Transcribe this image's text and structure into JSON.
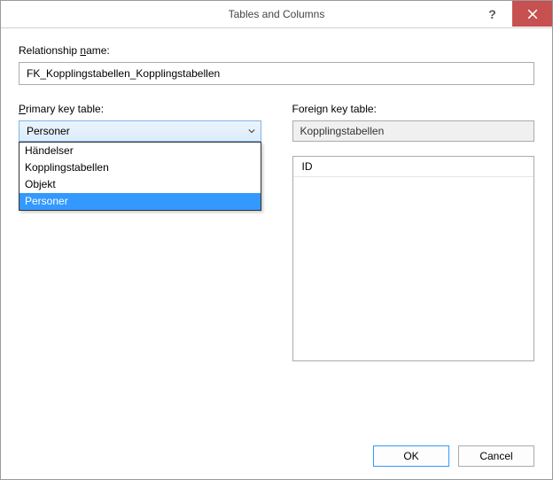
{
  "titlebar": {
    "title": "Tables and Columns"
  },
  "labels": {
    "relationship_name": "Relationship name:",
    "relationship_name_accesskey": "n",
    "primary_key_table": "Primary key table:",
    "primary_key_table_accesskey": "P",
    "foreign_key_table": "Foreign key table:"
  },
  "fields": {
    "relationship_name_value": "FK_Kopplingstabellen_Kopplingstabellen",
    "primary_selected": "Personer",
    "foreign_table": "Kopplingstabellen"
  },
  "dropdown": {
    "items": [
      "Händelser",
      "Kopplingstabellen",
      "Objekt",
      "Personer"
    ],
    "selected_index": 3
  },
  "grid": {
    "foreign_columns": [
      "ID"
    ]
  },
  "buttons": {
    "ok": "OK",
    "cancel": "Cancel"
  }
}
